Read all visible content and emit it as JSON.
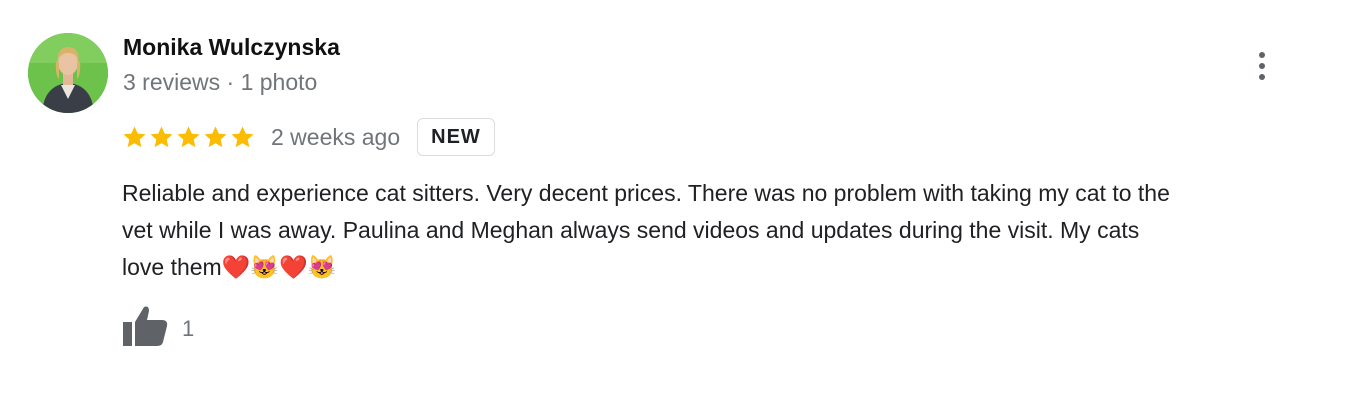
{
  "reviewer": {
    "name": "Monika Wulczynska",
    "meta": "3 reviews · 1 photo"
  },
  "rating": {
    "stars": 5,
    "max_stars": 5,
    "star_color": "#fbbc04"
  },
  "review": {
    "date": "2 weeks ago",
    "badge": "NEW",
    "text_lines": [
      "Reliable and experience cat sitters. Very decent prices. There was no problem with taking my cat to the",
      "vet while I was away. Paulina and Meghan always send videos and updates during the visit. My cats",
      "love them❤️😻❤️😻"
    ]
  },
  "actions": {
    "like_icon": "thumbs-up-icon",
    "like_count": "1",
    "more_icon": "more-vert-icon"
  },
  "colors": {
    "secondary_text": "#70757a",
    "icon_gray": "#5f6368",
    "avatar_bg": "#6cc24a"
  }
}
